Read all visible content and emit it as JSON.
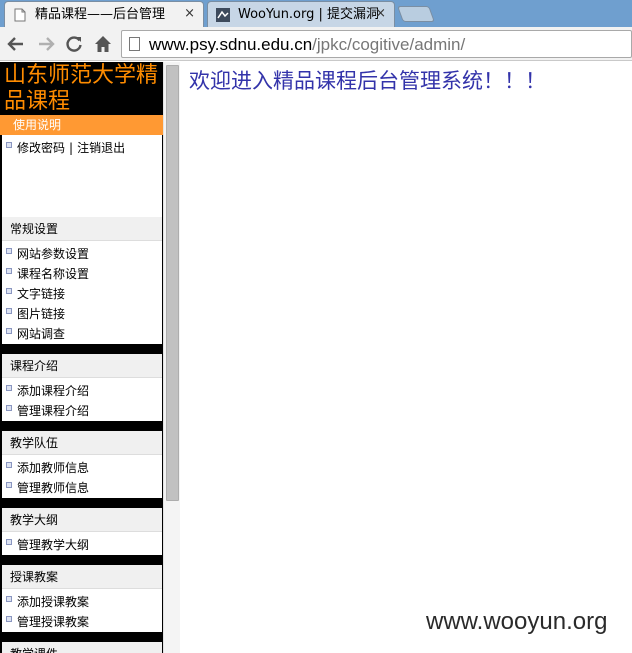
{
  "browser": {
    "tabs": [
      {
        "title": "精品课程——后台管理",
        "close": "×",
        "favicon": "page-icon"
      },
      {
        "title": "WooYun.org | 提交漏洞",
        "close": "×",
        "favicon": "wooyun-logo-icon"
      }
    ],
    "url_host": "www.psy.sdnu.edu.cn",
    "url_path": "/jpkc/cogitive/admin/"
  },
  "sidebar": {
    "site_title": "山东师范大学精品课程",
    "usage": "使用说明",
    "account": {
      "change_password": "修改密码",
      "separator": "|",
      "logout": "注销退出"
    },
    "sections": [
      {
        "title": "常规设置",
        "items": [
          "网站参数设置",
          "课程名称设置",
          "文字链接",
          "图片链接",
          "网站调查"
        ]
      },
      {
        "title": "课程介绍",
        "items": [
          "添加课程介绍",
          "管理课程介绍"
        ]
      },
      {
        "title": "教学队伍",
        "items": [
          "添加教师信息",
          "管理教师信息"
        ]
      },
      {
        "title": "教学大纲",
        "items": [
          "管理教学大纲"
        ]
      },
      {
        "title": "授课教案",
        "items": [
          "添加授课教案",
          "管理授课教案"
        ]
      },
      {
        "title": "教学课件",
        "items": []
      }
    ]
  },
  "main": {
    "welcome": "欢迎进入精品课程后台管理系统！！！"
  },
  "watermark": "www.wooyun.org",
  "colors": {
    "tabstrip": "#6f9fcf",
    "site_title": "#ff8c00",
    "usage_bar": "#ff9933",
    "welcome_text": "#3333aa"
  }
}
